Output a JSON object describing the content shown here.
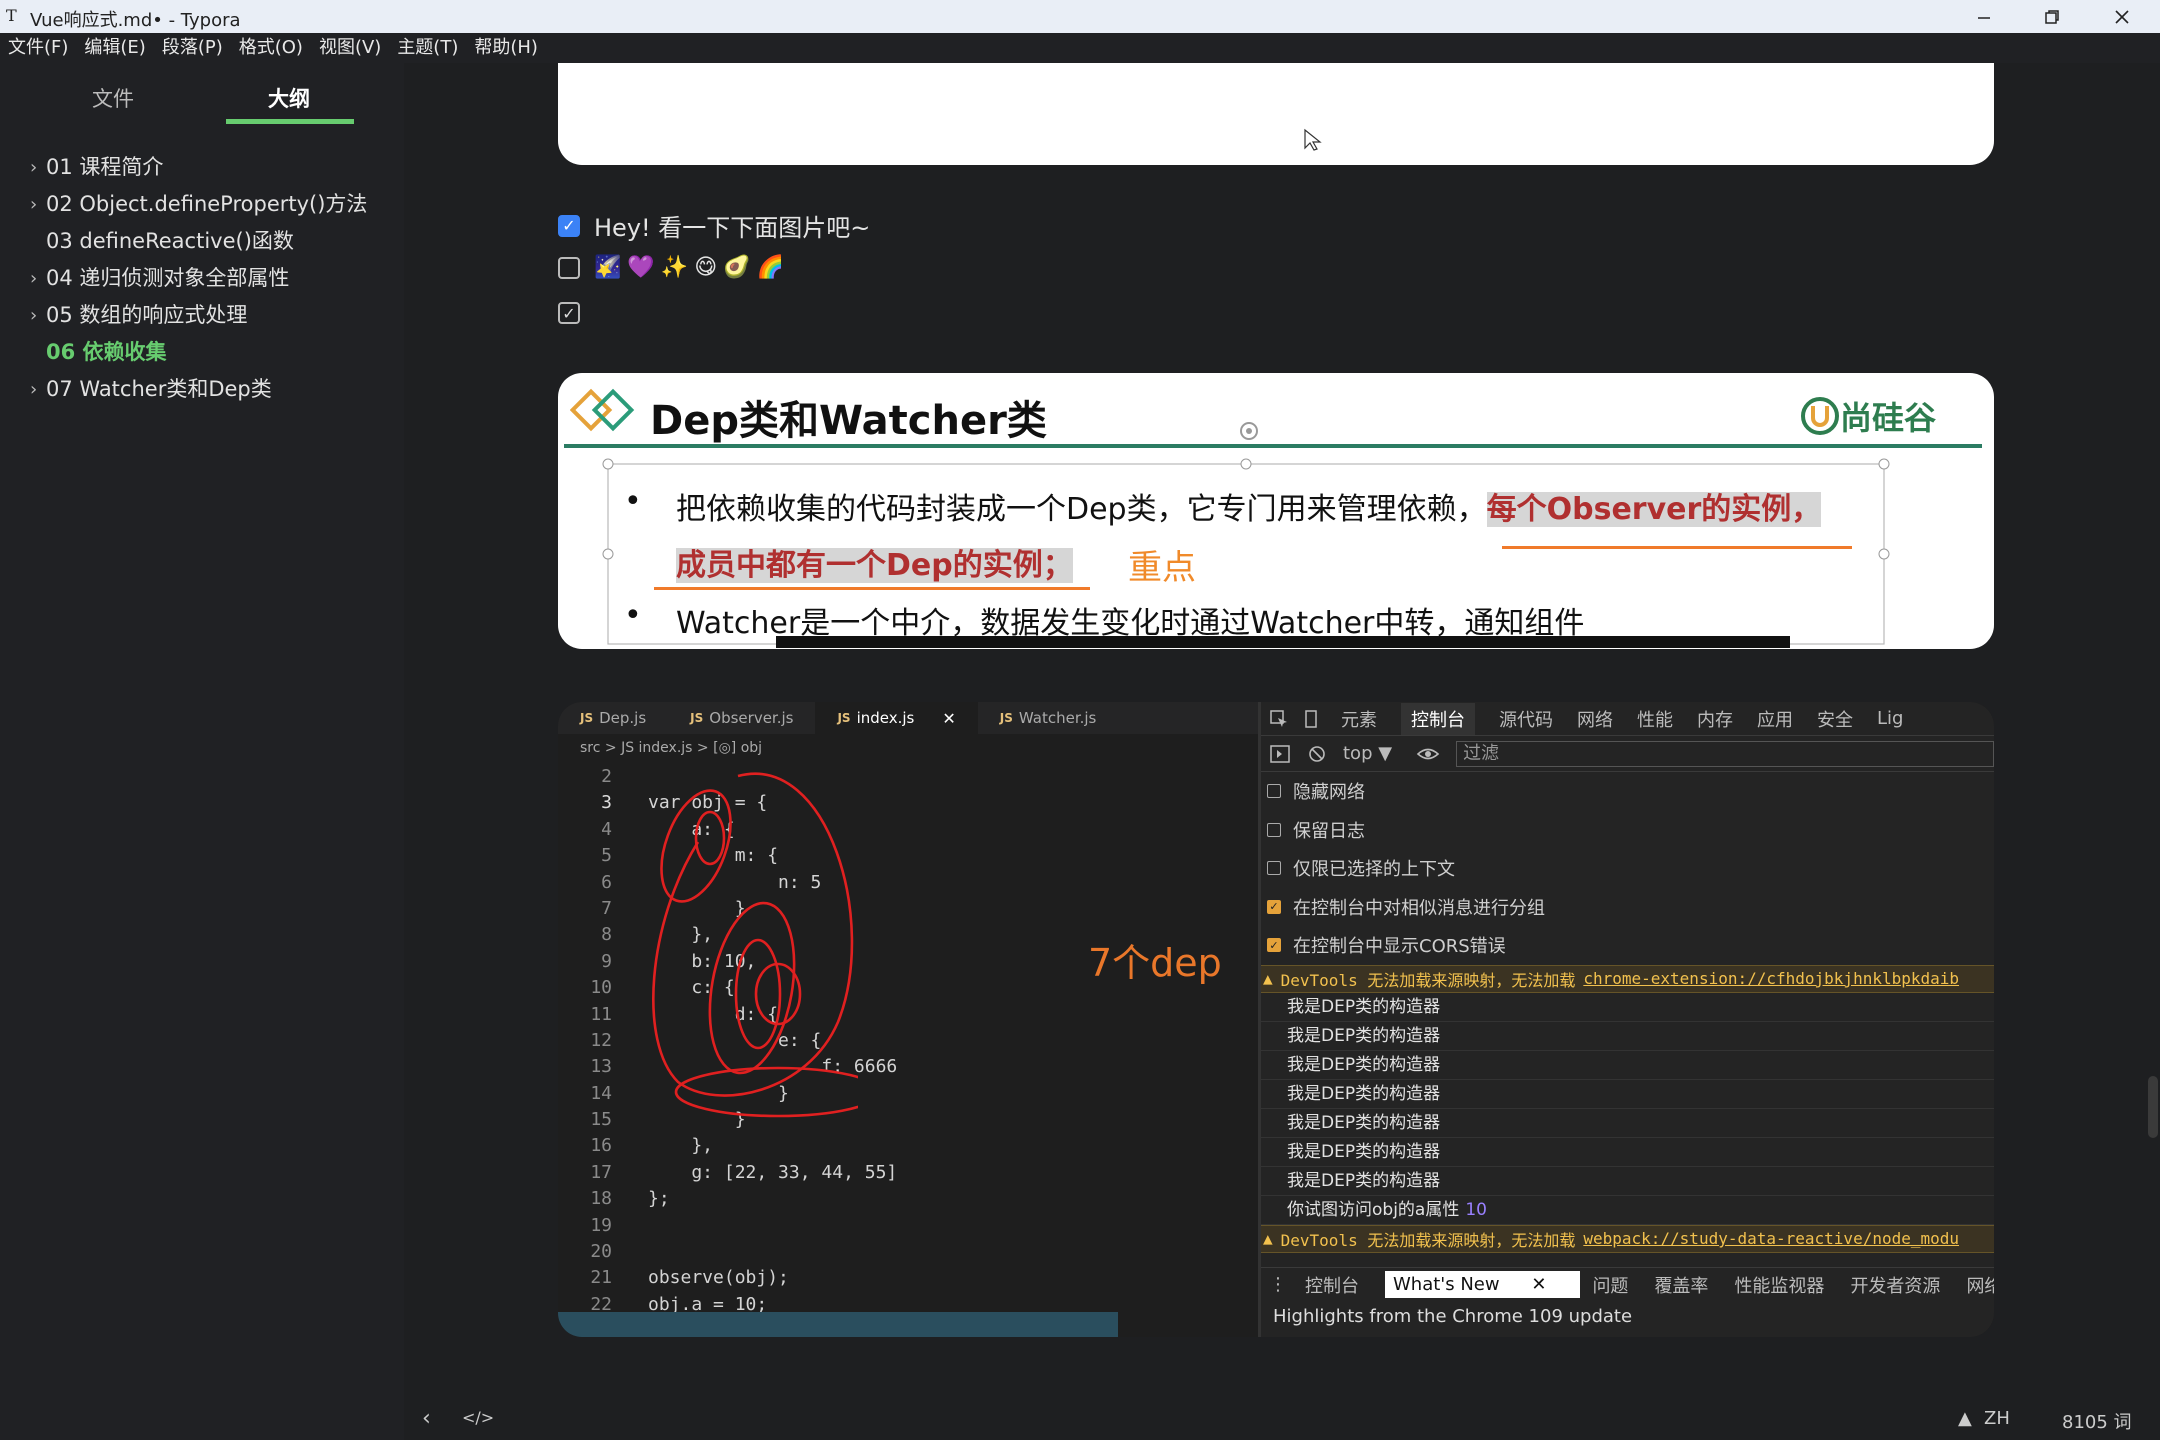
{
  "window": {
    "app_icon": "T",
    "title": "Vue响应式.md• - Typora"
  },
  "menu": [
    "文件(F)",
    "编辑(E)",
    "段落(P)",
    "格式(O)",
    "视图(V)",
    "主题(T)",
    "帮助(H)"
  ],
  "sidebar": {
    "tabs": {
      "files": "文件",
      "outline": "大纲"
    },
    "outline": [
      {
        "label": "01 课程简介",
        "chevron": true
      },
      {
        "label": "02 Object.defineProperty()方法",
        "chevron": true
      },
      {
        "label": "03 defineReactive()函数",
        "chevron": false
      },
      {
        "label": "04 递归侦测对象全部属性",
        "chevron": true
      },
      {
        "label": "05 数组的响应式处理",
        "chevron": true
      },
      {
        "label": "06 依赖收集",
        "chevron": false,
        "active": true
      },
      {
        "label": "07 Watcher类和Dep类",
        "chevron": true
      }
    ]
  },
  "tasks": {
    "t1": "Hey! 看一下下面图片吧~",
    "t2_emojis": [
      "🌠",
      "💜",
      "✨",
      "😋",
      "🥑",
      "🌈"
    ]
  },
  "slide": {
    "title": "Dep类和Watcher类",
    "brand": "尚硅谷",
    "bullet1_a": "把依赖收集的代码封装成一个Dep类，它专门用来管理依赖，",
    "bullet1_hl": "每个Observer的实例，",
    "bullet1_hl2": "成员中都有一个Dep的实例；",
    "key_note": "重点",
    "bullet2": "Watcher是一个中介，数据发生变化时通过Watcher中转，通知组件"
  },
  "editor": {
    "tabs": [
      "Dep.js",
      "Observer.js",
      "index.js",
      "Watcher.js"
    ],
    "breadcrumb": "src > JS index.js > [◎] obj",
    "annotation": "7个dep",
    "lines": [
      {
        "n": "2",
        "code": ""
      },
      {
        "n": "3",
        "code": "var obj = {"
      },
      {
        "n": "4",
        "code": "    a: {"
      },
      {
        "n": "5",
        "code": "        m: {"
      },
      {
        "n": "6",
        "code": "            n: 5"
      },
      {
        "n": "7",
        "code": "        }"
      },
      {
        "n": "8",
        "code": "    },"
      },
      {
        "n": "9",
        "code": "    b: 10,"
      },
      {
        "n": "10",
        "code": "    c: {"
      },
      {
        "n": "11",
        "code": "        d: {"
      },
      {
        "n": "12",
        "code": "            e: {"
      },
      {
        "n": "13",
        "code": "                f: 6666"
      },
      {
        "n": "14",
        "code": "            }"
      },
      {
        "n": "15",
        "code": "        }"
      },
      {
        "n": "16",
        "code": "    },"
      },
      {
        "n": "17",
        "code": "    g: [22, 33, 44, 55]"
      },
      {
        "n": "18",
        "code": "};"
      },
      {
        "n": "19",
        "code": ""
      },
      {
        "n": "20",
        "code": ""
      },
      {
        "n": "21",
        "code": "observe(obj);"
      },
      {
        "n": "22",
        "code": "obj.a = 10;"
      }
    ]
  },
  "devtools": {
    "tabs": [
      "元素",
      "控制台",
      "源代码",
      "网络",
      "性能",
      "内存",
      "应用",
      "安全",
      "Lig"
    ],
    "context": "top ▼",
    "filter_placeholder": "过滤",
    "options": [
      {
        "label": "隐藏网络",
        "checked": false
      },
      {
        "label": "保留日志",
        "checked": false
      },
      {
        "label": "仅限已选择的上下文",
        "checked": false
      },
      {
        "label": "在控制台中对相似消息进行分组",
        "checked": true
      },
      {
        "label": "在控制台中显示CORS错误",
        "checked": true
      }
    ],
    "warn1": {
      "text": "DevTools 无法加载来源映射，无法加载",
      "link": "chrome-extension://cfhdojbkjhnklbpkdaib"
    },
    "logs": [
      "我是DEP类的构造器",
      "我是DEP类的构造器",
      "我是DEP类的构造器",
      "我是DEP类的构造器",
      "我是DEP类的构造器",
      "我是DEP类的构造器",
      "我是DEP类的构造器"
    ],
    "log_a_text": "你试图访问obj的a属性",
    "log_a_value": "10",
    "warn2": {
      "text": "DevTools 无法加载来源映射，无法加载",
      "link": "webpack://study-data-reactive/node_modu"
    },
    "drawer_tabs": [
      "控制台",
      "What's New",
      "问题",
      "覆盖率",
      "性能监视器",
      "开发者资源",
      "网络"
    ],
    "whatsnew": "Highlights from the Chrome 109 update"
  },
  "status": {
    "lang": "ZH",
    "words": "8105 词"
  }
}
